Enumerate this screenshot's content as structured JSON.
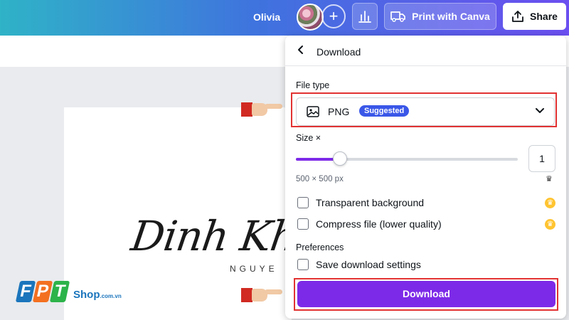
{
  "header": {
    "user_name": "Olivia",
    "print_label": "Print with Canva",
    "share_label": "Share",
    "plus_label": "+"
  },
  "canvas": {
    "signature_text": "Dinh Khai",
    "signature_sub": "NGUYE"
  },
  "watermark": {
    "logo_letters": [
      "F",
      "P",
      "T"
    ],
    "shop_text": "Shop",
    "shop_domain": ".com.vn"
  },
  "download_panel": {
    "title": "Download",
    "file_type_label": "File type",
    "file_type_value": "PNG",
    "suggested_badge": "Suggested",
    "size_label": "Size ×",
    "size_value": "1",
    "size_slider_fraction": 0.2,
    "dimensions": "500 × 500 px",
    "options": [
      {
        "label": "Transparent background",
        "checked": false,
        "pro": true
      },
      {
        "label": "Compress file (lower quality)",
        "checked": false,
        "pro": true
      }
    ],
    "preferences_label": "Preferences",
    "save_settings_label": "Save download settings",
    "download_button": "Download"
  },
  "colors": {
    "accent": "#7d2ae8",
    "badge": "#3a57e8",
    "highlight": "#e23232",
    "pro_crown": "#ffc431"
  },
  "icons": [
    "chevron-left-icon",
    "image-icon",
    "chevron-down-icon",
    "crown-icon",
    "insights-icon",
    "truck-icon",
    "share-upload-icon",
    "pointing-hand-icon"
  ]
}
